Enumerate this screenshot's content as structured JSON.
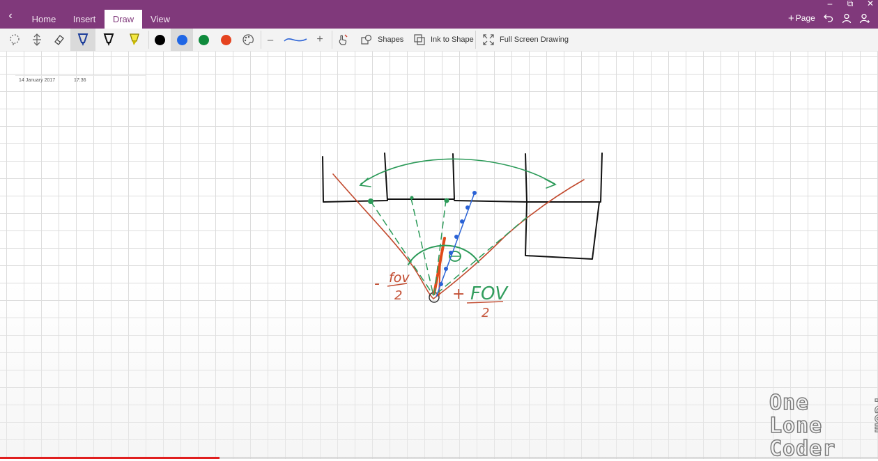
{
  "titlebar": {
    "tabs": [
      {
        "label": "Home",
        "active": false
      },
      {
        "label": "Insert",
        "active": false
      },
      {
        "label": "Draw",
        "active": true
      },
      {
        "label": "View",
        "active": false
      }
    ],
    "page_button_label": "Page",
    "accent_color": "#80397b"
  },
  "toolbar": {
    "pen_colors": [
      "#000000",
      "#1f66e5",
      "#0f8a3c",
      "#e5431f"
    ],
    "selected_color": "#1f66e5",
    "shapes_label": "Shapes",
    "ink_to_shape_label": "Ink to Shape",
    "full_screen_label": "Full Screen Drawing"
  },
  "page": {
    "date": "14 January 2017",
    "time": "17:36"
  },
  "drawing": {
    "labels": {
      "left_sign": "-",
      "left_top": "fov",
      "left_bottom": "2",
      "right_sign": "+",
      "right_top": "FOV",
      "right_bottom": "2",
      "angle_symbol": "θ"
    },
    "ink_colors": {
      "walls": "#111111",
      "fov_lines": "#c24a2e",
      "rays": "#2b9a58",
      "ray_dots": "#2a62d6"
    }
  },
  "watermark": {
    "line1": "One",
    "line2": "Lone",
    "line3": "Coder",
    "domain": ".com"
  },
  "video": {
    "progress": 0.25
  }
}
